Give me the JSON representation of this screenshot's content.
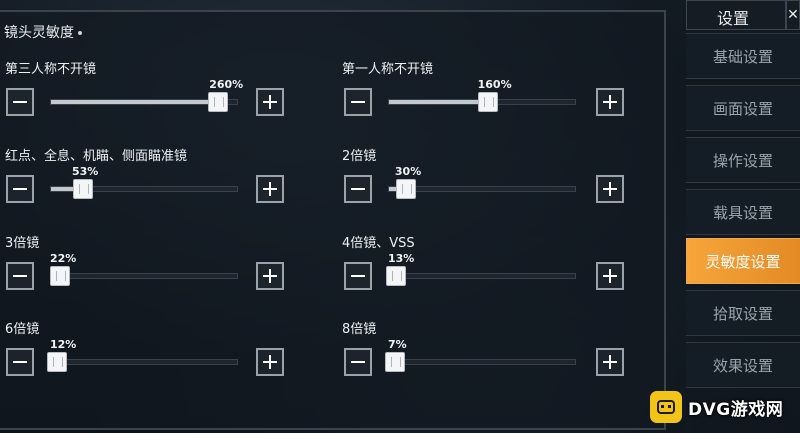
{
  "section": {
    "title": "镜头灵敏度"
  },
  "sliders": [
    {
      "label": "第三人称不开镜",
      "value_text": "260%",
      "level": 0.9
    },
    {
      "label": "第一人称不开镜",
      "value_text": "160%",
      "level": 0.53
    },
    {
      "label": "红点、全息、机瞄、侧面瞄准镜",
      "value_text": "53%",
      "level": 0.17
    },
    {
      "label": "2倍镜",
      "value_text": "30%",
      "level": 0.09
    },
    {
      "label": "3倍镜",
      "value_text": "22%",
      "level": 0.05
    },
    {
      "label": "4倍镜、VSS",
      "value_text": "13%",
      "level": 0.04
    },
    {
      "label": "6倍镜",
      "value_text": "12%",
      "level": 0.03
    },
    {
      "label": "8倍镜",
      "value_text": "7%",
      "level": 0.03
    }
  ],
  "sidebar": {
    "header": "设置",
    "close_icon": "close-icon",
    "items": [
      {
        "label": "基础设置",
        "active": false
      },
      {
        "label": "画面设置",
        "active": false
      },
      {
        "label": "操作设置",
        "active": false
      },
      {
        "label": "载具设置",
        "active": false
      },
      {
        "label": "灵敏度设置",
        "active": true
      },
      {
        "label": "拾取设置",
        "active": false
      },
      {
        "label": "效果设置",
        "active": false
      }
    ]
  },
  "watermark": {
    "text": "DVG游戏网"
  },
  "colors": {
    "accent": "#f0a036",
    "panel_border": "#3a444e",
    "track_fill": "#c4c8cc"
  }
}
